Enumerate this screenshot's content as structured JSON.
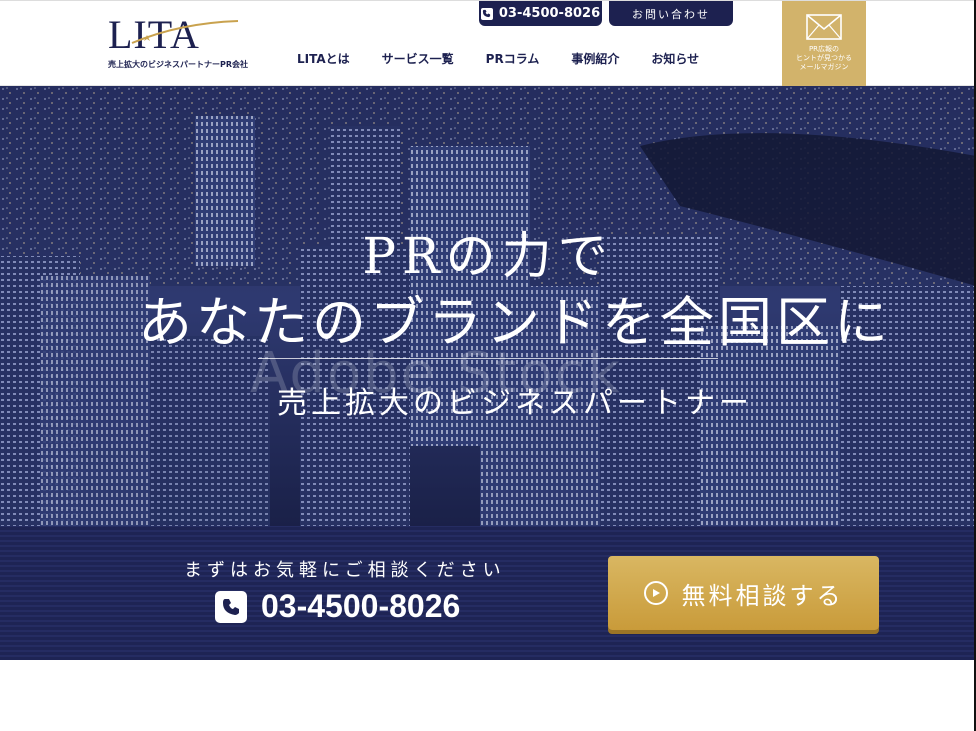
{
  "header": {
    "logo_text": "LITA",
    "logo_tagline": "売上拡大のビジネスパートナーPR会社",
    "phone": "03-4500-8026",
    "contact_label": "お問い合わせ",
    "nav": [
      {
        "label": "LITAとは"
      },
      {
        "label": "サービス一覧"
      },
      {
        "label": "PRコラム"
      },
      {
        "label": "事例紹介"
      },
      {
        "label": "お知らせ"
      }
    ],
    "magazine": {
      "line1": "PR広報の",
      "line2": "ヒントが見つかる",
      "line3": "メールマガジン",
      "icon": "mail-icon"
    }
  },
  "hero": {
    "title_line1": "PRの力で",
    "title_line2": "あなたのブランドを全国区に",
    "subtitle": "売上拡大のビジネスパートナー",
    "watermark": "Adobe Stock"
  },
  "cta": {
    "lead": "まずはお気軽にご相談ください",
    "phone": "03-4500-8026",
    "button_label": "無料相談する"
  },
  "colors": {
    "navy": "#1d2150",
    "gold": "#d2b36b"
  }
}
